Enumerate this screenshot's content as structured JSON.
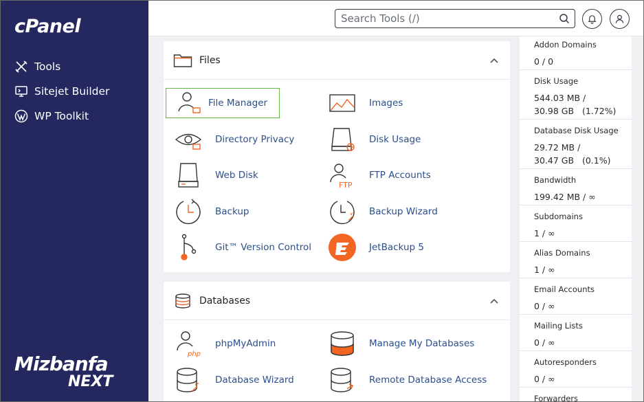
{
  "sidebar": {
    "logo": "cPanel",
    "items": [
      {
        "label": "Tools",
        "icon": "tools-icon"
      },
      {
        "label": "Sitejet Builder",
        "icon": "sitejet-icon"
      },
      {
        "label": "WP Toolkit",
        "icon": "wordpress-icon"
      }
    ],
    "brand": {
      "line1": "Mizbanfa",
      "line2": "NEXT"
    }
  },
  "header": {
    "search_placeholder": "Search Tools (/)",
    "icons": [
      "search-icon",
      "bell-icon",
      "user-icon"
    ]
  },
  "files": {
    "title": "Files",
    "tools": [
      {
        "label": "File Manager",
        "icon": "file-manager-icon"
      },
      {
        "label": "Images",
        "icon": "images-icon"
      },
      {
        "label": "Directory Privacy",
        "icon": "directory-privacy-icon"
      },
      {
        "label": "Disk Usage",
        "icon": "disk-usage-icon"
      },
      {
        "label": "Web Disk",
        "icon": "web-disk-icon"
      },
      {
        "label": "FTP Accounts",
        "icon": "ftp-accounts-icon"
      },
      {
        "label": "Backup",
        "icon": "backup-icon"
      },
      {
        "label": "Backup Wizard",
        "icon": "backup-wizard-icon"
      },
      {
        "label": "Git™ Version Control",
        "icon": "git-icon"
      },
      {
        "label": "JetBackup 5",
        "icon": "jetbackup-icon"
      }
    ]
  },
  "databases": {
    "title": "Databases",
    "tools": [
      {
        "label": "phpMyAdmin",
        "icon": "phpmyadmin-icon"
      },
      {
        "label": "Manage My Databases",
        "icon": "manage-databases-icon"
      },
      {
        "label": "Database Wizard",
        "icon": "database-wizard-icon"
      },
      {
        "label": "Remote Database Access",
        "icon": "remote-database-icon"
      }
    ]
  },
  "stats": [
    {
      "label": "Addon Domains",
      "value": "0 / 0"
    },
    {
      "label": "Disk Usage",
      "value1": "544.03 MB /",
      "value2": "30.98 GB   (1.72%)"
    },
    {
      "label": "Database Disk Usage",
      "value1": "29.72 MB /",
      "value2": "30.47 GB   (0.1%)"
    },
    {
      "label": "Bandwidth",
      "value": "199.42 MB / ∞"
    },
    {
      "label": "Subdomains",
      "value": "1 / ∞"
    },
    {
      "label": "Alias Domains",
      "value": "1 / ∞"
    },
    {
      "label": "Email Accounts",
      "value": "0 / ∞"
    },
    {
      "label": "Mailing Lists",
      "value": "0 / ∞"
    },
    {
      "label": "Autoresponders",
      "value": "0 / ∞"
    },
    {
      "label": "Forwarders",
      "value": ""
    }
  ],
  "colors": {
    "sidebar": "#24285e",
    "link": "#2b4f8c",
    "accent_orange": "#f26522",
    "active_border": "#66b54a"
  }
}
